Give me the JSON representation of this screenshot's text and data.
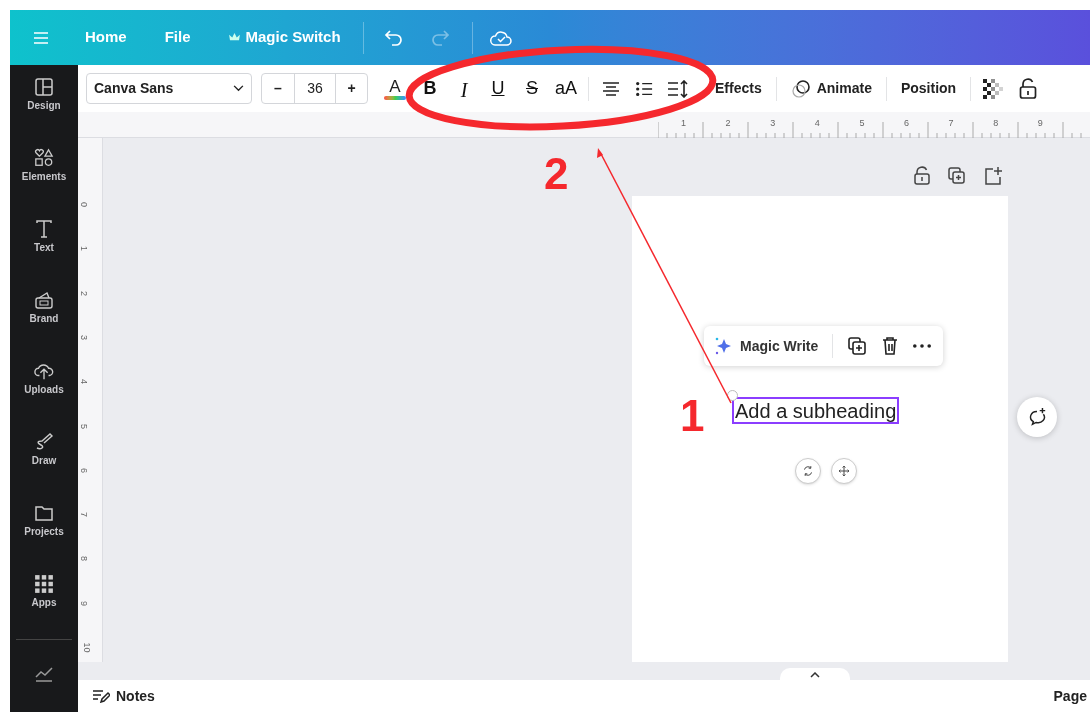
{
  "top_bar": {
    "nav": [
      {
        "label": "Home",
        "kind": "plain"
      },
      {
        "label": "File",
        "kind": "plain"
      },
      {
        "label": "Magic Switch",
        "kind": "crown"
      }
    ],
    "undo": {
      "disabled": false
    },
    "redo": {
      "disabled": true
    }
  },
  "sidebar": {
    "items": [
      {
        "label": "Design",
        "kind": "design"
      },
      {
        "label": "Elements",
        "kind": "elements"
      },
      {
        "label": "Text",
        "kind": "text"
      },
      {
        "label": "Brand",
        "kind": "brand"
      },
      {
        "label": "Uploads",
        "kind": "uploads"
      },
      {
        "label": "Draw",
        "kind": "draw"
      },
      {
        "label": "Projects",
        "kind": "projects"
      },
      {
        "label": "Apps",
        "kind": "apps"
      },
      {
        "kind": "charts"
      }
    ]
  },
  "toolbar": {
    "font": "Canva Sans",
    "decrease": "–",
    "font_size": "36",
    "increase": "+",
    "text_color": "A",
    "format_buttons": [
      {
        "label": "B",
        "kind": "bold"
      },
      {
        "label": "I",
        "kind": "italic"
      },
      {
        "label": "U",
        "kind": "underline"
      },
      {
        "label": "S",
        "kind": "strike"
      },
      {
        "label": "aA",
        "kind": "case"
      }
    ],
    "actions": [
      {
        "label": "Effects",
        "kind": "plain"
      },
      {
        "label": "Animate",
        "kind": "animate"
      },
      {
        "label": "Position",
        "kind": "plain"
      }
    ]
  },
  "rulers": {
    "horizontal": [
      "1",
      "2",
      "3",
      "4",
      "5",
      "6",
      "7",
      "8",
      "9"
    ],
    "vertical": [
      "0",
      "1",
      "2",
      "3",
      "4",
      "5",
      "6",
      "7",
      "8",
      "9",
      "10"
    ]
  },
  "canvas": {
    "context_menu": {
      "label": "Magic Write"
    },
    "text_element": "Add a subheading"
  },
  "annotations": [
    {
      "label": "1"
    },
    {
      "label": "2"
    }
  ],
  "bottom_bar": {
    "notes": "Notes",
    "page": "Page"
  }
}
